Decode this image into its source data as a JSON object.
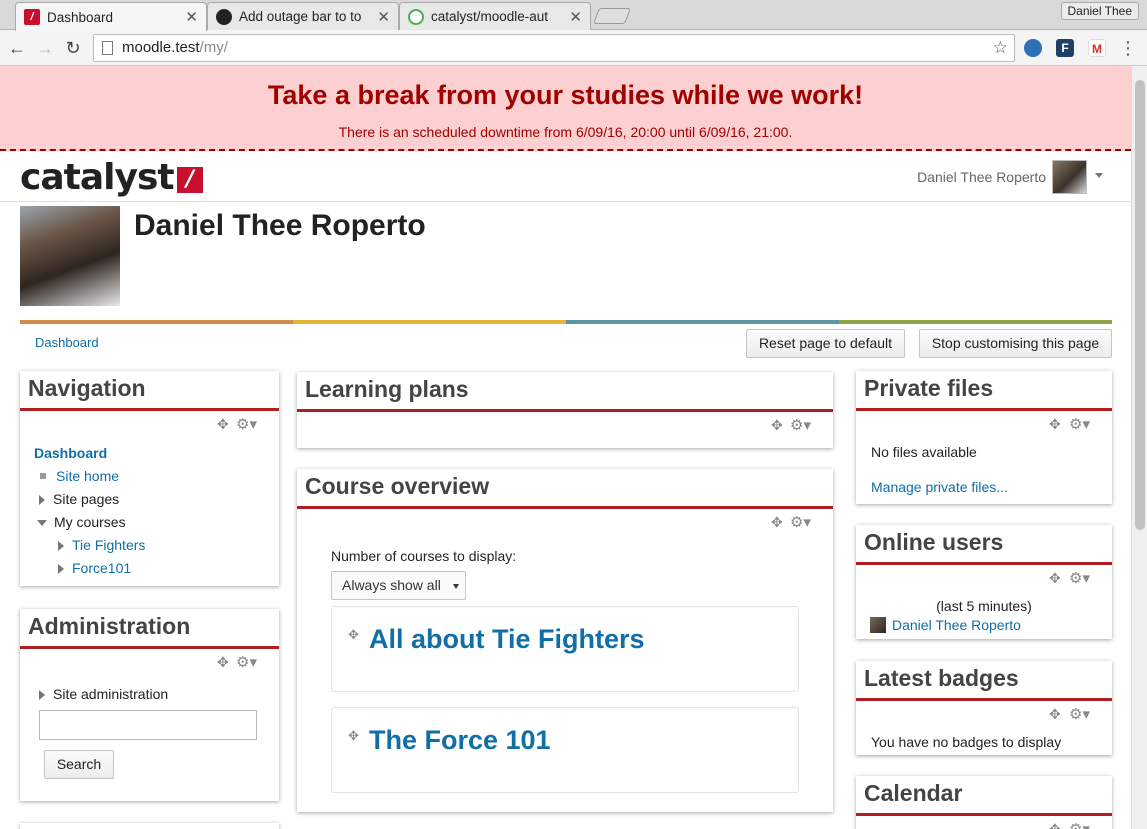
{
  "browser": {
    "tabs": [
      {
        "title": "Dashboard",
        "active": true
      },
      {
        "title": "Add outage bar to to"
      },
      {
        "title": "catalyst/moodle-aut"
      }
    ],
    "profile_name": "Daniel Thee",
    "url_host": "moodle.test",
    "url_path": "/my/"
  },
  "outage": {
    "title": "Take a break from your studies while we work!",
    "message": "There is an scheduled downtime from 6/09/16, 20:00 until 6/09/16, 21:00."
  },
  "header": {
    "logo_text": "catalyst",
    "user_name": "Daniel Thee Roperto"
  },
  "page": {
    "heading": "Daniel Thee Roperto",
    "breadcrumb": "Dashboard",
    "reset_button": "Reset page to default",
    "stop_button": "Stop customising this page",
    "stripe_colors": [
      "#d5894b",
      "#e4b53b",
      "#5d96a3",
      "#8fa444"
    ]
  },
  "navigation": {
    "title": "Navigation",
    "dashboard": "Dashboard",
    "site_home": "Site home",
    "site_pages": "Site pages",
    "my_courses": "My courses",
    "courses": [
      "Tie Fighters",
      "Force101"
    ]
  },
  "administration": {
    "title": "Administration",
    "site_admin": "Site administration",
    "search_button": "Search"
  },
  "learning_plans": {
    "title": "Learning plans"
  },
  "course_overview": {
    "title": "Course overview",
    "display_label": "Number of courses to display:",
    "display_value": "Always show all",
    "courses": [
      "All about Tie Fighters",
      "The Force 101"
    ]
  },
  "private_files": {
    "title": "Private files",
    "empty": "No files available",
    "manage": "Manage private files..."
  },
  "online_users": {
    "title": "Online users",
    "period": "(last 5 minutes)",
    "user": "Daniel Thee Roperto"
  },
  "latest_badges": {
    "title": "Latest badges",
    "empty": "You have no badges to display"
  },
  "calendar": {
    "title": "Calendar"
  }
}
